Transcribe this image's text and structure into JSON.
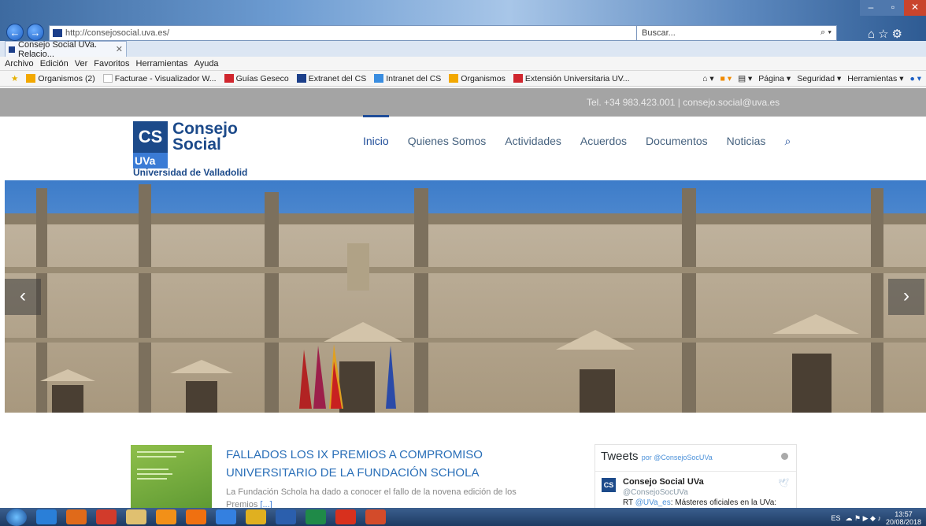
{
  "browser": {
    "url": "http://consejosocial.uva.es/",
    "search_placeholder": "Buscar...",
    "tab_title": "Consejo Social UVa. Relacio...",
    "menu": [
      "Archivo",
      "Edición",
      "Ver",
      "Favoritos",
      "Herramientas",
      "Ayuda"
    ],
    "favorites": [
      {
        "label": "Organismos (2)",
        "color": "#f2a800"
      },
      {
        "label": "Facturae - Visualizador W...",
        "color": "#ffffff"
      },
      {
        "label": "Guías Geseco",
        "color": "#d0262e"
      },
      {
        "label": "Extranet del CS",
        "color": "#1c3f8a"
      },
      {
        "label": "Intranet del CS",
        "color": "#3a8de0"
      },
      {
        "label": "Organismos",
        "color": "#f2a800"
      },
      {
        "label": "Extensión Universitaria UV...",
        "color": "#d0262e"
      }
    ],
    "tools": [
      "Página ▾",
      "Seguridad ▾",
      "Herramientas ▾"
    ]
  },
  "site": {
    "contact": "Tel. +34 983.423.001 | consejo.social@uva.es",
    "logo": {
      "cs": "CS",
      "uva": "UVa",
      "line1": "Consejo",
      "line2": "Social",
      "university": "Universidad de Valladolid"
    },
    "nav": [
      "Inicio",
      "Quienes Somos",
      "Actividades",
      "Acuerdos",
      "Documentos",
      "Noticias"
    ],
    "slider": {
      "prev": "‹",
      "next": "›"
    }
  },
  "news": {
    "title": "FALLADOS LOS IX PREMIOS A COMPROMISO UNIVERSITARIO DE LA FUNDACIÓN SCHOLA",
    "excerpt": "La Fundación Schola ha dado a conocer el fallo de la novena edición de los",
    "excerpt_end": "Premios",
    "more": "[...]"
  },
  "tweets": {
    "title": "Tweets",
    "by": "por @ConsejoSocUVa",
    "account_name": "Consejo Social UVa",
    "handle": "@ConsejoSocUVa",
    "rt": "RT",
    "mention": "@UVa_es",
    "text": ": Másteres oficiales en la UVa:"
  },
  "taskbar": {
    "lang": "ES",
    "time": "13:57",
    "date": "20/08/2018"
  }
}
